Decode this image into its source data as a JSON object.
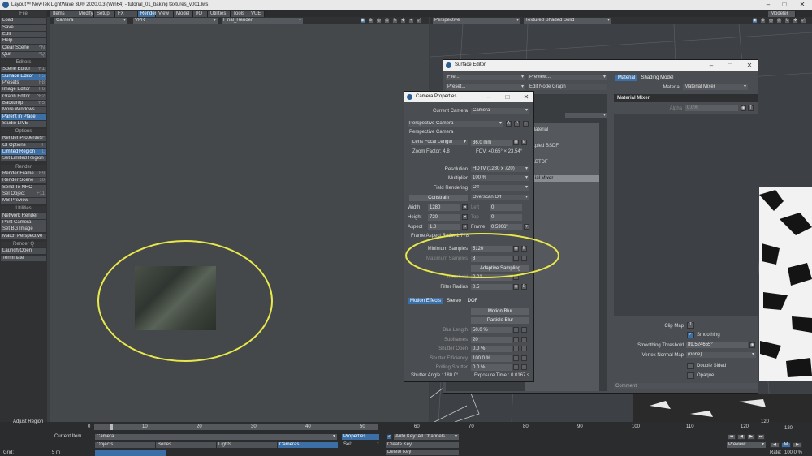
{
  "window": {
    "title": "Layout™ NewTek LightWave 3D® 2020.0.3 (Win64) - tutorial_01_baking textures_v001.lws",
    "modeler": "Modeler"
  },
  "menu_tabs": [
    "Items",
    "Modify",
    "Setup",
    "FX Tools",
    "Render",
    "View",
    "Model",
    "I/O",
    "Utilities",
    "Tools",
    "VUE"
  ],
  "left_items": [
    {
      "label": "File",
      "type": "section"
    },
    {
      "label": "Load"
    },
    {
      "label": "Save"
    },
    {
      "label": "Edit"
    },
    {
      "label": "Help"
    },
    {
      "label": "Clear Scene",
      "sc": "^N"
    },
    {
      "label": "Quit",
      "sc": "^Q"
    },
    {
      "label": "Editors",
      "type": "section"
    },
    {
      "label": "Scene Editor",
      "sc": "^F1"
    },
    {
      "label": "Surface Editor",
      "sc": "F5",
      "hl": true
    },
    {
      "label": "Presets",
      "sc": "F8"
    },
    {
      "label": "Image Editor",
      "sc": "F6"
    },
    {
      "label": "Graph Editor",
      "sc": "^F2"
    },
    {
      "label": "Backdrop",
      "sc": "^F5"
    },
    {
      "label": "More Windows"
    },
    {
      "label": "Parent in Place",
      "hl": true
    },
    {
      "label": "Studio LIVE"
    },
    {
      "label": "Options",
      "type": "section"
    },
    {
      "label": "Render Properties",
      "sc": "F"
    },
    {
      "label": "GI Options",
      "sc": "F"
    },
    {
      "label": "Limited Region",
      "sc": "L",
      "hl": true
    },
    {
      "label": "Set Limited Region"
    },
    {
      "label": "Render",
      "type": "section"
    },
    {
      "label": "Render Frame",
      "sc": "F9"
    },
    {
      "label": "Render Scene",
      "sc": "F10"
    },
    {
      "label": "Send To NRC"
    },
    {
      "label": "Sel Object",
      "sc": "F11"
    },
    {
      "label": "MB Preview"
    },
    {
      "label": "Utilities",
      "type": "section"
    },
    {
      "label": "Network Render"
    },
    {
      "label": "Print Camera"
    },
    {
      "label": "Set BG Image"
    },
    {
      "label": "Match Perspective"
    },
    {
      "label": "Render Q",
      "type": "section"
    },
    {
      "label": "Launch/Open"
    },
    {
      "label": "Terminate"
    }
  ],
  "left_viewport": {
    "view": "Camera",
    "render_mode": "VPR",
    "render_target": "Final_Render"
  },
  "right_viewport": {
    "view": "Perspective",
    "shading": "Textured Shaded Solid"
  },
  "surface_editor": {
    "title": "Surface Editor",
    "file": "File...",
    "preview": "Preview...",
    "preset": "Preset...",
    "edit_node": "Edit Node Graph",
    "tabs": [
      "Material",
      "Shading Model"
    ],
    "material_label": "Material",
    "material_value": "Material Mixer",
    "section_title": "Material Mixer",
    "alpha_label": "Alpha",
    "alpha_value": "0.0%",
    "list_items": [
      "Material",
      "...pled BSDF",
      "...BTDF",
      "...ial Mixer"
    ],
    "clip_map": "Clip Map",
    "clip_map_btn": "T",
    "smoothing": "Smoothing",
    "smoothing_threshold_label": "Smoothing Threshold",
    "smoothing_threshold_value": "89.524655°",
    "vertex_normal_label": "Vertex Normal Map",
    "vertex_normal_value": "(none)",
    "double_sided": "Double Sided",
    "opaque": "Opaque",
    "comment": "Comment"
  },
  "camera_props": {
    "title": "Camera Properties",
    "current_camera_label": "Current Camera",
    "current_camera": "Camera",
    "camera_type": "Perspective Camera",
    "camera_type_text": "Perspective Camera",
    "lens_focal": "Lens Focal Length",
    "lens_value": "36.0 mm",
    "zoom_factor": "Zoom Factor: 4.8",
    "fov": "FOV: 40.65° × 23.54°",
    "resolution_label": "Resolution",
    "resolution": "HDTV (1280 x 720)",
    "multiplier_label": "Multiplier",
    "multiplier": "100 %",
    "field_render_label": "Field Rendering",
    "field_render": "Off",
    "constrain": "Constrain",
    "overscan": "Overscan Off",
    "width_label": "Width",
    "width": "1280",
    "height_label": "Height",
    "height": "720",
    "left_label": "Left",
    "left": "0",
    "top_label": "Top",
    "top": "0",
    "aspect_label": "Aspect",
    "aspect": "1.0",
    "frame_label": "Frame",
    "frame": "0.5906\"",
    "frame_aspect": "Frame Aspect Ratio: 1.778",
    "min_samples_label": "Minimum Samples",
    "min_samples": "5120",
    "max_samples_label": "Maximum Samples",
    "max_samples": "8",
    "adaptive": "Adaptive Sampling",
    "threshold_label": "Threshold",
    "threshold": "0.01",
    "filter_radius_label": "Filter Radius",
    "filter_radius": "0.5",
    "tabs": [
      "Motion Effects",
      "Stereo",
      "DOF"
    ],
    "motion_blur": "Motion Blur",
    "particle_blur": "Particle Blur",
    "blur_length_label": "Blur Length",
    "blur_length": "50.0 %",
    "subframes_label": "Subframes",
    "subframes": "20",
    "shutter_open_label": "Shutter Open",
    "shutter_open": "0.0 %",
    "shutter_eff_label": "Shutter Efficiency",
    "shutter_eff": "100.0 %",
    "rolling_label": "Rolling Shutter",
    "rolling": "0.0 %",
    "shutter_angle": "Shutter Angle : 180.0°",
    "exposure": "Exposure Time : 0.0167 s"
  },
  "timeline": {
    "adjust_region": "Adjust Region",
    "ticks": [
      "0",
      "10",
      "20",
      "30",
      "40",
      "50",
      "60",
      "70",
      "80",
      "90",
      "100",
      "110",
      "120"
    ],
    "ticks_right": [
      "120",
      "120"
    ],
    "current_item_label": "Current Item",
    "current_item": "Camera",
    "properties": "Properties",
    "sel_label": "Sel:",
    "sel_value": "1",
    "auto_key": "Auto Key: All Channels",
    "objects": "Objects",
    "bones": "Bones",
    "lights": "Lights",
    "cameras": "Cameras",
    "create_key": "Create Key",
    "delete_key": "Delete Key",
    "grid_label": "Grid:",
    "grid_value": "5 m",
    "preview": "Preview",
    "rate_label": "Rate:",
    "rate": "100.0 %"
  }
}
